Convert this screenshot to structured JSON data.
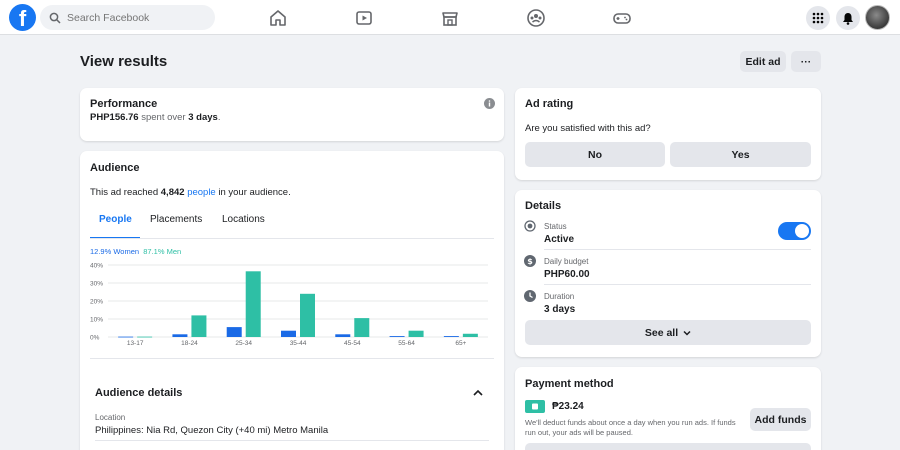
{
  "nav": {
    "search_placeholder": "Search Facebook",
    "icons": [
      "home-icon",
      "watch-icon",
      "marketplace-icon",
      "groups-icon",
      "gaming-icon"
    ],
    "right_icons": [
      "menu-grid-icon",
      "notifications-icon"
    ]
  },
  "header": {
    "title": "View results",
    "edit_label": "Edit ad",
    "more_label": "···"
  },
  "performance": {
    "title": "Performance",
    "amount": "PHP156.76",
    "spent_text": " spent over ",
    "days": "3 days",
    "period": "."
  },
  "audience": {
    "title": "Audience",
    "reach_prefix": "This ad reached ",
    "reach_count": "4,842",
    "reach_link": "people",
    "reach_suffix": " in your audience.",
    "tabs": [
      "People",
      "Placements",
      "Locations"
    ],
    "active_tab": "People",
    "legend_women": "12.9% Women",
    "legend_men": "87.1% Men"
  },
  "audience_details": {
    "title": "Audience details",
    "location_label": "Location",
    "location_value": "Philippines: Nia Rd, Quezon City (+40 mi) Metro Manila"
  },
  "ad_rating": {
    "title": "Ad rating",
    "question": "Are you satisfied with this ad?",
    "no_label": "No",
    "yes_label": "Yes"
  },
  "details": {
    "title": "Details",
    "status_label": "Status",
    "status_value": "Active",
    "status_on": true,
    "budget_label": "Daily budget",
    "budget_value": "PHP60.00",
    "duration_label": "Duration",
    "duration_value": "3 days",
    "see_all_label": "See all"
  },
  "payment": {
    "title": "Payment method",
    "balance": "₱23.24",
    "note": "We'll deduct funds about once a day when you run ads. If funds run out, your ads will be paused.",
    "add_funds_label": "Add funds"
  },
  "chart_data": {
    "type": "bar",
    "categories": [
      "13-17",
      "18-24",
      "25-34",
      "35-44",
      "45-54",
      "55-64",
      "65+"
    ],
    "series": [
      {
        "name": "Women",
        "color": "#1a6ae6",
        "values": [
          0.2,
          1.5,
          5.5,
          3.5,
          1.5,
          0.5,
          0.5
        ]
      },
      {
        "name": "Men",
        "color": "#2ebfa5",
        "values": [
          0.2,
          12,
          36.5,
          24,
          10.5,
          3.5,
          1.8
        ]
      }
    ],
    "yticks": [
      "40%",
      "30%",
      "20%",
      "10%",
      "0%"
    ],
    "ylim": [
      0,
      40
    ],
    "grid": true
  }
}
